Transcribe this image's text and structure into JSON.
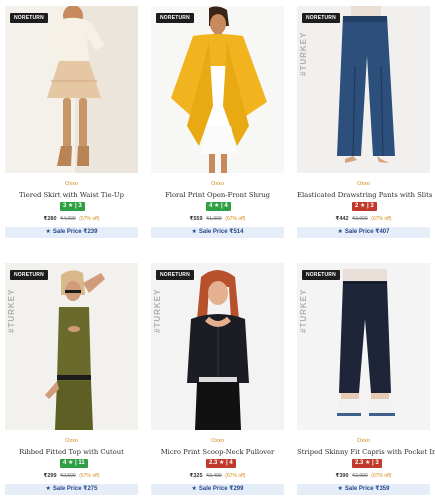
{
  "products": [
    {
      "badge": "NORETURN",
      "brand": "Oxxo",
      "title": "Tiered Skirt with Waist Tie-Up",
      "rating": "3 ★ | 3",
      "rating_color": "#2ea043",
      "price": "₹280",
      "mrp": "₹4,999",
      "off": "(67% off)",
      "sale": "Sale Price ₹239",
      "side_text": ""
    },
    {
      "badge": "NORETURN",
      "brand": "Oxxo",
      "title": "Floral Print Open-Front Shrug",
      "rating": "4 ★ | 4",
      "rating_color": "#2ea043",
      "price": "₹559",
      "mrp": "₹1,999",
      "off": "(67% off)",
      "sale": "Sale Price ₹514",
      "side_text": ""
    },
    {
      "badge": "NORETURN",
      "brand": "Oxxo",
      "title": "Elasticated Drawstring Pants with Slits",
      "rating": "2 ★ | 3",
      "rating_color": "#c0392b",
      "price": "₹442",
      "mrp": "₹3,999",
      "off": "(67% off)",
      "sale": "Sale Price ₹407",
      "side_text": "#TURKEY"
    },
    {
      "badge": "NORETURN",
      "brand": "Oxxo",
      "title": "Ribbed Fitted Top with Cutout",
      "rating": "4 ★ | 11",
      "rating_color": "#2ea043",
      "price": "₹299",
      "mrp": "₹2,599",
      "off": "(67% off)",
      "sale": "Sale Price ₹275",
      "side_text": "#TURKEY"
    },
    {
      "badge": "NORETURN",
      "brand": "Oxxo",
      "title": "Micro Print Scoop-Neck Pullover",
      "rating": "2.3 ★ | 4",
      "rating_color": "#c0392b",
      "price": "₹325",
      "mrp": "₹3,499",
      "off": "(67% off)",
      "sale": "Sale Price ₹299",
      "side_text": "#TURKEY"
    },
    {
      "badge": "NORETURN",
      "brand": "Oxxo",
      "title": "Striped Skinny Fit Capris with Pocket Inserts",
      "rating": "2.3 ★ | 3",
      "rating_color": "#c0392b",
      "price": "₹390",
      "mrp": "₹2,999",
      "off": "(67% off)",
      "sale": "Sale Price ₹359",
      "side_text": "#TURKEY"
    }
  ]
}
